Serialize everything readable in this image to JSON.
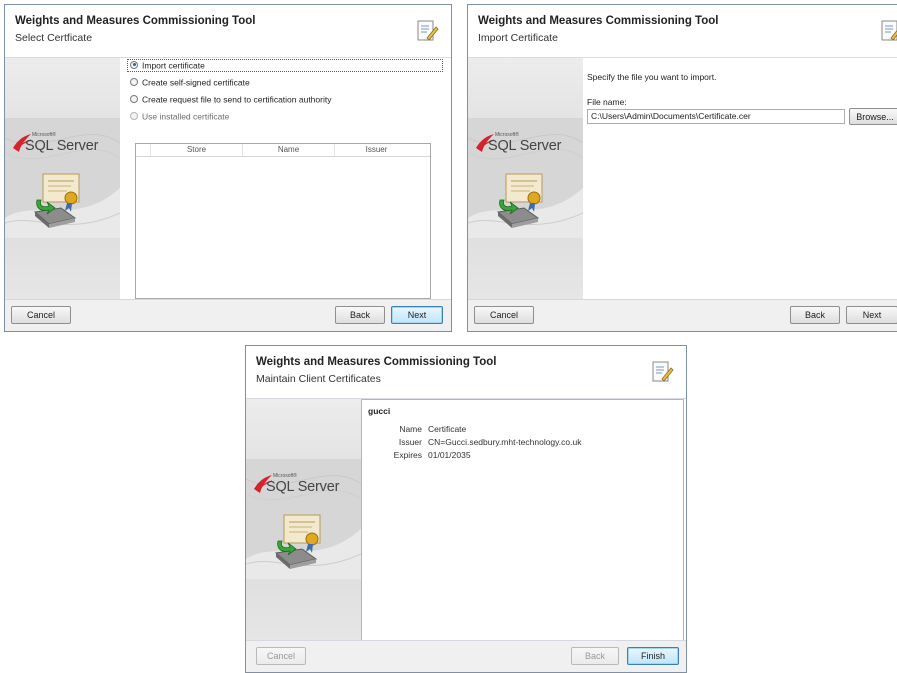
{
  "app_title": "Weights and Measures Commissioning Tool",
  "sidebar": {
    "brand": "SQL Server",
    "microsoft": "Microsoft®"
  },
  "dialog1": {
    "subtitle": "Select Certficate",
    "options": [
      {
        "label": "Import certificate",
        "checked": true,
        "enabled": true
      },
      {
        "label": "Create self-signed certificate",
        "checked": false,
        "enabled": true
      },
      {
        "label": "Create request file to send to certification authority",
        "checked": false,
        "enabled": true
      },
      {
        "label": "Use installed certificate",
        "checked": false,
        "enabled": false
      }
    ],
    "table": {
      "columns": [
        "Store",
        "Name",
        "Issuer"
      ],
      "rows": []
    },
    "buttons": {
      "cancel": "Cancel",
      "back": "Back",
      "next": "Next"
    }
  },
  "dialog2": {
    "subtitle": "Import Certificate",
    "instruction": "Specify the file you want to import.",
    "file_label": "File name:",
    "file_value": "C:\\Users\\Admin\\Documents\\Certificate.cer",
    "browse": "Browse...",
    "buttons": {
      "cancel": "Cancel",
      "back": "Back",
      "next": "Next"
    }
  },
  "dialog3": {
    "subtitle": "Maintain Client Certificates",
    "client": "gucci",
    "fields": [
      {
        "key": "Name",
        "value": "Certificate"
      },
      {
        "key": "Issuer",
        "value": "CN=Gucci.sedbury.mht-technology.co.uk"
      },
      {
        "key": "Expires",
        "value": "01/01/2035"
      }
    ],
    "buttons": {
      "cancel": "Cancel",
      "back": "Back",
      "finish": "Finish"
    }
  },
  "colors": {
    "accent": "#2466a8",
    "border": "#7f8fa6",
    "footer": "#f0f0f0"
  },
  "icons": [
    "wizard-header-icon",
    "sql-server-logo-icon",
    "certificate-icon",
    "radio-icon"
  ]
}
